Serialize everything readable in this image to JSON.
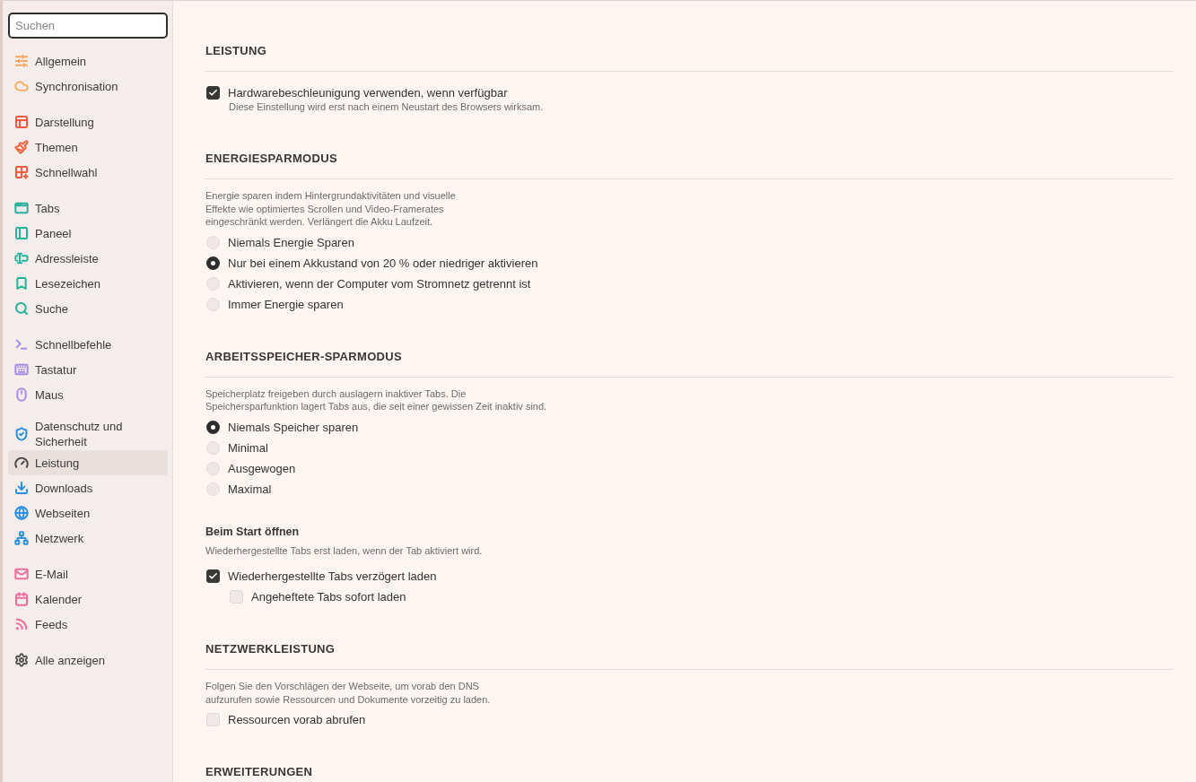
{
  "sidebar": {
    "search": {
      "placeholder": "Suchen"
    },
    "groups": [
      {
        "items": [
          {
            "label": "Allgemein",
            "color": "#f5a55a",
            "selected": false
          },
          {
            "label": "Synchronisation",
            "color": "#f5b266",
            "selected": false
          }
        ]
      },
      {
        "items": [
          {
            "label": "Darstellung",
            "color": "#ee5a3c",
            "selected": false
          },
          {
            "label": "Themen",
            "color": "#ee6a44",
            "selected": false
          },
          {
            "label": "Schnellwahl",
            "color": "#ee5a3c",
            "selected": false
          }
        ]
      },
      {
        "items": [
          {
            "label": "Tabs",
            "color": "#27b09a",
            "selected": false
          },
          {
            "label": "Paneel",
            "color": "#27b09a",
            "selected": false
          },
          {
            "label": "Adressleiste",
            "color": "#27b09a",
            "selected": false
          },
          {
            "label": "Lesezeichen",
            "color": "#27b09a",
            "selected": false
          },
          {
            "label": "Suche",
            "color": "#27b09a",
            "selected": false
          }
        ]
      },
      {
        "items": [
          {
            "label": "Schnellbefehle",
            "color": "#a78be6",
            "selected": false
          },
          {
            "label": "Tastatur",
            "color": "#a78be6",
            "selected": false
          },
          {
            "label": "Maus",
            "color": "#a78be6",
            "selected": false
          }
        ]
      },
      {
        "items": [
          {
            "label": "Datenschutz und Sicherheit",
            "color": "#2d8fe0",
            "selected": false
          },
          {
            "label": "Leistung",
            "color": "#444444",
            "selected": true
          },
          {
            "label": "Downloads",
            "color": "#2d8fe0",
            "selected": false
          },
          {
            "label": "Webseiten",
            "color": "#2d8fe0",
            "selected": false
          },
          {
            "label": "Netzwerk",
            "color": "#2d8fe0",
            "selected": false
          }
        ]
      },
      {
        "items": [
          {
            "label": "E-Mail",
            "color": "#ee6d9e",
            "selected": false
          },
          {
            "label": "Kalender",
            "color": "#ee6d9e",
            "selected": false
          },
          {
            "label": "Feeds",
            "color": "#ee6d9e",
            "selected": false
          }
        ]
      },
      {
        "items": [
          {
            "label": "Alle anzeigen",
            "color": "#555555",
            "selected": false
          }
        ]
      }
    ]
  },
  "main": {
    "sections": [
      {
        "title": "LEISTUNG",
        "blocks": [
          {
            "kind": "checkbox",
            "label": "Hardwarebeschleunigung verwenden, wenn verfügbar",
            "checked": true,
            "hint": "Diese Einstellung wird erst nach einem Neustart des Browsers wirksam."
          }
        ]
      },
      {
        "title": "ENERGIESPARMODUS",
        "blocks": [
          {
            "kind": "description",
            "text": "Energie sparen indem Hintergrundaktivitäten und visuelle\nEffekte wie optimiertes Scrollen und Video-Framerates\neingeschränkt werden. Verlängert die Akku Laufzeit."
          },
          {
            "kind": "radio_group",
            "options": [
              {
                "label": "Niemals Energie Sparen",
                "selected": false
              },
              {
                "label": "Nur bei einem Akkustand von 20 % oder niedriger aktivieren",
                "selected": true
              },
              {
                "label": "Aktivieren, wenn der Computer vom Stromnetz getrennt ist",
                "selected": false
              },
              {
                "label": "Immer Energie sparen",
                "selected": false
              }
            ]
          }
        ]
      },
      {
        "title": "ARBEITSSPEICHER-SPARMODUS",
        "blocks": [
          {
            "kind": "description",
            "text": "Speicherplatz freigeben durch auslagern inaktiver Tabs. Die\nSpeichersparfunktion lagert Tabs aus, die seit einer gewissen Zeit inaktiv sind."
          },
          {
            "kind": "radio_group",
            "options": [
              {
                "label": "Niemals Speicher sparen",
                "selected": true
              },
              {
                "label": "Minimal",
                "selected": false
              },
              {
                "label": "Ausgewogen",
                "selected": false
              },
              {
                "label": "Maximal",
                "selected": false
              }
            ]
          },
          {
            "kind": "subsection",
            "title": "Beim Start öffnen",
            "description": "Wiederhergestellte Tabs erst laden, wenn der Tab aktiviert wird.",
            "items": [
              {
                "kind": "checkbox",
                "label": "Wiederhergestellte Tabs verzögert laden",
                "checked": true,
                "children": [
                  {
                    "kind": "checkbox",
                    "label": "Angeheftete Tabs sofort laden",
                    "checked": false
                  }
                ]
              }
            ]
          }
        ]
      },
      {
        "title": "NETZWERKLEISTUNG",
        "blocks": [
          {
            "kind": "description",
            "text": "Folgen Sie den Vorschlägen der Webseite, um vorab den DNS\naufzurufen sowie Ressourcen und Dokumente vorzeitig zu laden."
          },
          {
            "kind": "checkbox",
            "label": "Ressourcen vorab abrufen",
            "checked": false
          }
        ]
      },
      {
        "title": "ERWEITERUNGEN"
      }
    ]
  }
}
